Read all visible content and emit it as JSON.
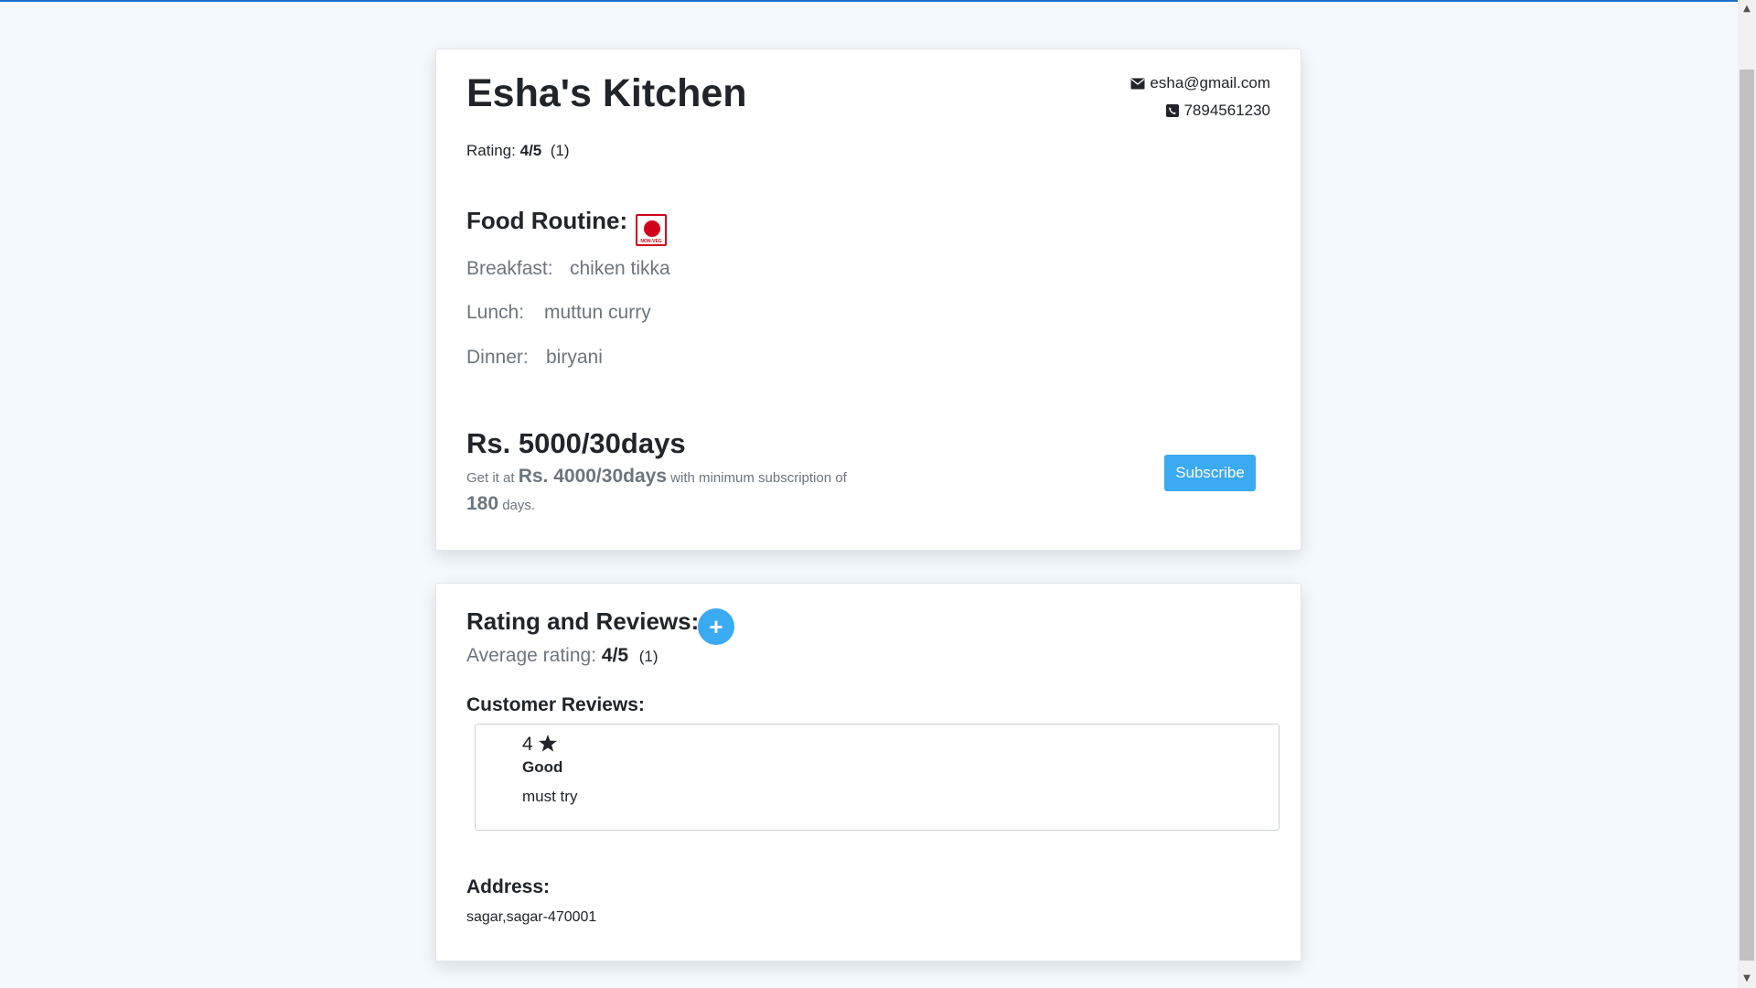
{
  "kitchen": {
    "name": "Esha's Kitchen",
    "email": "esha@gmail.com",
    "phone": "7894561230",
    "rating_prefix": "Rating:",
    "rating_value": "4/5",
    "rating_count": "(1)"
  },
  "food_routine": {
    "title": "Food Routine:",
    "badge_text": "NON-VEG",
    "breakfast_label": "Breakfast:",
    "breakfast_value": "chiken tikka",
    "lunch_label": "Lunch:",
    "lunch_value": "muttun curry",
    "dinner_label": "Dinner:",
    "dinner_value": "biryani"
  },
  "pricing": {
    "price": "Rs. 5000/30days",
    "offer_prefix": "Get it at",
    "offer_price": "Rs. 4000/30days",
    "offer_middle": "with minimum subscription of",
    "offer_days": "180",
    "offer_suffix": "days.",
    "subscribe_label": "Subscribe"
  },
  "reviews": {
    "title": "Rating and Reviews:",
    "add_icon": "+",
    "avg_prefix": "Average rating:",
    "avg_value": "4/5",
    "avg_count": "(1)",
    "customer_title": "Customer Reviews:",
    "items": [
      {
        "stars": "4",
        "title": "Good",
        "body": "must try"
      }
    ]
  },
  "address": {
    "title": "Address:",
    "value": "sagar,sagar-470001"
  },
  "colors": {
    "accent": "#3aaaf2",
    "nonveg": "#d0021b",
    "background": "#f4f9fd"
  },
  "icons": {
    "email": "envelope-icon",
    "phone": "phone-icon",
    "star": "star-icon",
    "add": "plus-icon"
  }
}
